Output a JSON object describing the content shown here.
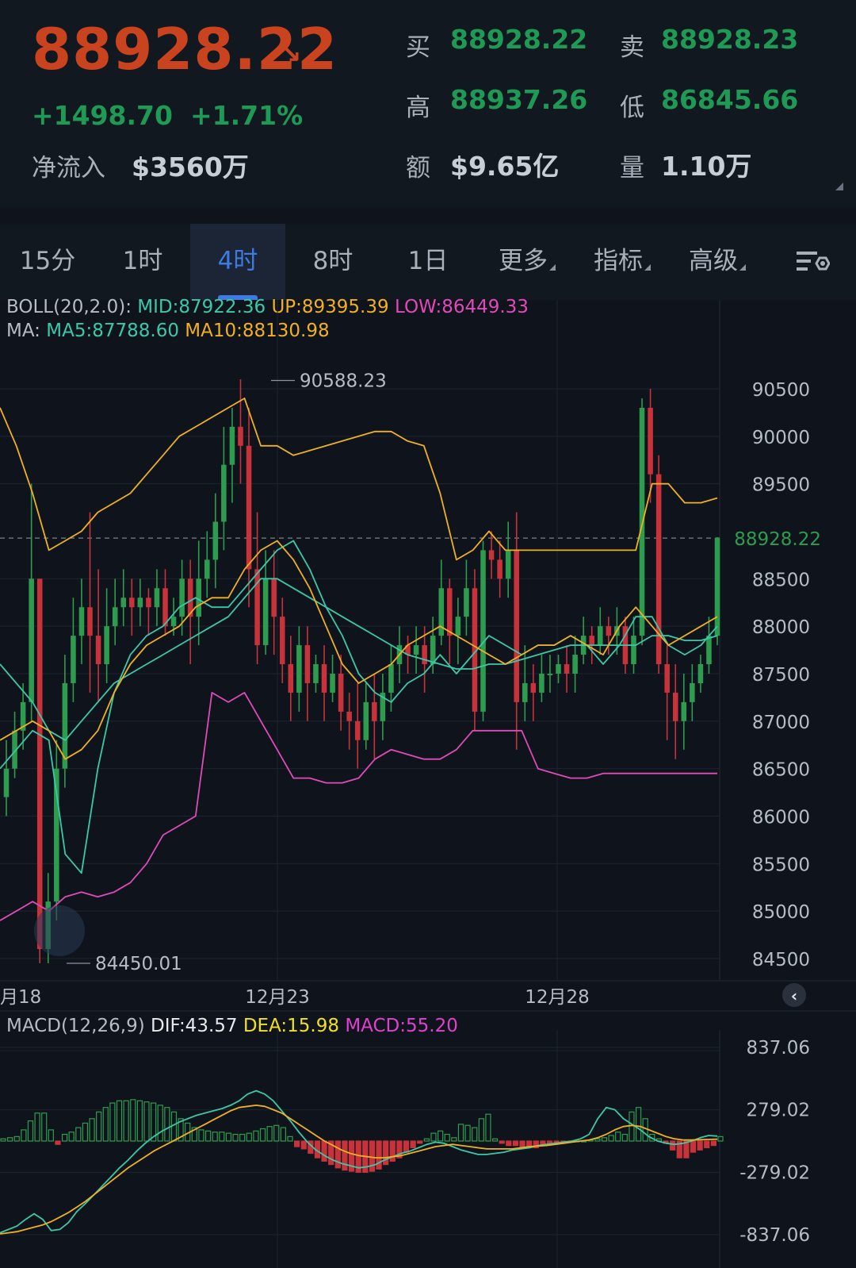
{
  "header": {
    "price": "88928.22",
    "change": "+1498.70",
    "change_pct": "+1.71%",
    "netflow_label": "净流入",
    "netflow_value": "$3560万",
    "bid_label": "买",
    "bid_value": "88928.22",
    "ask_label": "卖",
    "ask_value": "88928.23",
    "high_label": "高",
    "high_value": "88937.26",
    "low_label": "低",
    "low_value": "86845.66",
    "amount_label": "额",
    "amount_value": "$9.65亿",
    "volume_label": "量",
    "volume_value": "1.10万"
  },
  "tabs": [
    {
      "label": "15分"
    },
    {
      "label": "1时"
    },
    {
      "label": "4时"
    },
    {
      "label": "8时"
    },
    {
      "label": "1日"
    },
    {
      "label": "更多"
    },
    {
      "label": "指标"
    },
    {
      "label": "高级"
    }
  ],
  "active_tab": "4时",
  "indicators": {
    "boll_name": "BOLL(20,2.0):",
    "boll_mid": "MID:87922.36",
    "boll_up": "UP:89395.39",
    "boll_low": "LOW:86449.33",
    "ma_name": "MA:",
    "ma5": "MA5:87788.60",
    "ma10": "MA10:88130.98",
    "macd_name": "MACD(12,26,9)",
    "dif": "DIF:43.57",
    "dea": "DEA:15.98",
    "macd": "MACD:55.20"
  },
  "colors": {
    "up": "#2e9c4e",
    "down": "#c8323a",
    "boll_up_low_mid": "#f0b020",
    "boll_lower": "#e04ab8",
    "mid_line": "#3cc8a8",
    "ma5": "#3cc8a8",
    "ma10": "#f0b020",
    "price_accent": "#c8431e"
  },
  "chart_data": [
    {
      "type": "candlestick",
      "title": "",
      "y_ticks": [
        "90500",
        "90000",
        "89500",
        "88928.22",
        "88500",
        "88000",
        "87500",
        "87000",
        "86500",
        "86000",
        "85500",
        "85000",
        "84500"
      ],
      "ylim": [
        84400,
        90700
      ],
      "x_labels": [
        "月18",
        "12月23",
        "12月28"
      ],
      "high_mark": "90588.23",
      "low_mark": "84450.01",
      "last_price": 88928.22,
      "candles": [
        [
          86200,
          86500,
          86000,
          86800
        ],
        [
          86500,
          86900,
          86400,
          87100
        ],
        [
          86900,
          87200,
          86700,
          87400
        ],
        [
          87200,
          88500,
          87000,
          89500
        ],
        [
          88500,
          84600,
          84450,
          88500
        ],
        [
          84600,
          85100,
          84450,
          85400
        ],
        [
          85100,
          86500,
          84900,
          86800
        ],
        [
          86500,
          87400,
          86300,
          87700
        ],
        [
          87400,
          87900,
          87200,
          88300
        ],
        [
          87900,
          88200,
          87600,
          88500
        ],
        [
          88200,
          87900,
          87300,
          89200
        ],
        [
          87900,
          87600,
          87200,
          88600
        ],
        [
          87600,
          88000,
          87400,
          88400
        ],
        [
          88000,
          88200,
          87800,
          88500
        ],
        [
          88200,
          88300,
          88000,
          88600
        ],
        [
          88300,
          88200,
          87900,
          88500
        ],
        [
          88200,
          88300,
          88000,
          88500
        ],
        [
          88300,
          88200,
          87900,
          88400
        ],
        [
          88200,
          88400,
          88000,
          88600
        ],
        [
          88400,
          88000,
          87900,
          88600
        ],
        [
          88000,
          88100,
          87900,
          88300
        ],
        [
          88100,
          88500,
          87900,
          88700
        ],
        [
          88500,
          88100,
          87600,
          88700
        ],
        [
          88100,
          88500,
          87800,
          88900
        ],
        [
          88500,
          88700,
          88300,
          89000
        ],
        [
          88700,
          89100,
          88400,
          89400
        ],
        [
          89100,
          89700,
          88800,
          90100
        ],
        [
          89700,
          90100,
          89300,
          90300
        ],
        [
          90100,
          89900,
          89500,
          90600
        ],
        [
          89900,
          88600,
          88200,
          90300
        ],
        [
          88600,
          87800,
          87600,
          89200
        ],
        [
          87800,
          88500,
          87700,
          88800
        ],
        [
          88500,
          88100,
          87700,
          88800
        ],
        [
          88100,
          87600,
          87400,
          88300
        ],
        [
          87600,
          87300,
          87000,
          87900
        ],
        [
          87300,
          87800,
          87100,
          88000
        ],
        [
          87800,
          87400,
          87000,
          88000
        ],
        [
          87400,
          87600,
          87300,
          87700
        ],
        [
          87600,
          87300,
          87000,
          87800
        ],
        [
          87300,
          87500,
          87200,
          87700
        ],
        [
          87500,
          87100,
          86900,
          87700
        ],
        [
          87100,
          87000,
          86700,
          87300
        ],
        [
          87000,
          86800,
          86500,
          87400
        ],
        [
          86800,
          87200,
          86700,
          87400
        ],
        [
          87200,
          87000,
          86600,
          87500
        ],
        [
          87000,
          87300,
          86800,
          87500
        ],
        [
          87300,
          87600,
          87100,
          87800
        ],
        [
          87600,
          87800,
          87400,
          88000
        ],
        [
          87800,
          87700,
          87500,
          87900
        ],
        [
          87700,
          87800,
          87500,
          88000
        ],
        [
          87800,
          87600,
          87300,
          88000
        ],
        [
          87600,
          87900,
          87500,
          88100
        ],
        [
          87900,
          88400,
          87800,
          88700
        ],
        [
          88400,
          87900,
          87600,
          88500
        ],
        [
          87900,
          88100,
          87600,
          88300
        ],
        [
          88100,
          88400,
          87900,
          88700
        ],
        [
          88400,
          87100,
          86900,
          88600
        ],
        [
          87100,
          88800,
          87000,
          88900
        ],
        [
          88800,
          88700,
          88500,
          89000
        ],
        [
          88700,
          88500,
          88300,
          88900
        ],
        [
          88500,
          88800,
          88300,
          89100
        ],
        [
          88800,
          87200,
          86700,
          89200
        ],
        [
          87200,
          87400,
          87000,
          87800
        ],
        [
          87400,
          87300,
          87000,
          87600
        ],
        [
          87300,
          87500,
          87200,
          87700
        ],
        [
          87500,
          87500,
          87300,
          87700
        ],
        [
          87500,
          87600,
          87400,
          87700
        ],
        [
          87600,
          87500,
          87300,
          87800
        ],
        [
          87500,
          87700,
          87300,
          87900
        ],
        [
          87700,
          87900,
          87600,
          88100
        ],
        [
          87900,
          87800,
          87600,
          88000
        ],
        [
          87800,
          88000,
          87700,
          88200
        ],
        [
          88000,
          87900,
          87700,
          88100
        ],
        [
          87900,
          88000,
          87700,
          88200
        ],
        [
          88000,
          87600,
          87500,
          88100
        ],
        [
          87600,
          87900,
          87500,
          88100
        ],
        [
          87900,
          90300,
          87800,
          90400
        ],
        [
          90300,
          89600,
          89300,
          90500
        ],
        [
          89600,
          87600,
          87500,
          89800
        ],
        [
          87600,
          87300,
          86800,
          87800
        ],
        [
          87300,
          87000,
          86600,
          87600
        ],
        [
          87000,
          87200,
          86700,
          87500
        ],
        [
          87200,
          87400,
          87000,
          87600
        ],
        [
          87400,
          87600,
          87300,
          87700
        ],
        [
          87600,
          87900,
          87500,
          88100
        ],
        [
          87900,
          88928,
          87800,
          88937
        ]
      ],
      "series": [
        {
          "name": "UP",
          "values": [
            90300,
            89900,
            89400,
            88800,
            88900,
            89000,
            89200,
            89300,
            89400,
            89600,
            89800,
            90000,
            90100,
            90200,
            90300,
            90400,
            89900,
            89900,
            89800,
            89850,
            89900,
            89950,
            90000,
            90050,
            90050,
            89950,
            89900,
            89400,
            88700,
            88800,
            89000,
            88800,
            88800,
            88800,
            88800,
            88800,
            88800,
            88800,
            88800,
            88800,
            89500,
            89500,
            89300,
            89300,
            89350
          ]
        },
        {
          "name": "MID",
          "values": [
            87600,
            87400,
            87200,
            86900,
            86800,
            87000,
            87200,
            87400,
            87500,
            87600,
            87700,
            87800,
            87900,
            88000,
            88100,
            88300,
            88500,
            88500,
            88400,
            88300,
            88200,
            88100,
            88000,
            87900,
            87800,
            87700,
            87650,
            87600,
            87550,
            87550,
            87600,
            87600,
            87650,
            87700,
            87750,
            87800,
            87800,
            87800,
            87800,
            87800,
            87900,
            87900,
            87850,
            87850,
            87900
          ]
        },
        {
          "name": "LOW",
          "values": [
            84900,
            85000,
            85100,
            85000,
            85150,
            85200,
            85150,
            85200,
            85300,
            85500,
            85800,
            85900,
            86000,
            87300,
            87200,
            87300,
            87000,
            86700,
            86400,
            86400,
            86350,
            86350,
            86400,
            86600,
            86700,
            86650,
            86600,
            86600,
            86700,
            86900,
            86900,
            86900,
            86900,
            86500,
            86450,
            86400,
            86400,
            86450,
            86450,
            86450,
            86450,
            86450,
            86450,
            86450,
            86450
          ]
        },
        {
          "name": "MA5",
          "values": [
            86500,
            86700,
            86900,
            86800,
            85600,
            85400,
            86500,
            87300,
            87700,
            87900,
            88000,
            88200,
            88300,
            88200,
            88200,
            88400,
            88600,
            88800,
            88900,
            88600,
            88200,
            87900,
            87500,
            87300,
            87200,
            87400,
            87500,
            87700,
            87500,
            87700,
            87900,
            87800,
            87700,
            87800,
            87800,
            87900,
            87800,
            87600,
            87800,
            88100,
            88100,
            87800,
            87700,
            87800,
            88000
          ]
        },
        {
          "name": "MA10",
          "values": [
            86800,
            86900,
            87000,
            86900,
            86600,
            86700,
            86900,
            87300,
            87600,
            87800,
            87900,
            88000,
            88200,
            88300,
            88300,
            88600,
            88800,
            88900,
            88700,
            88400,
            88000,
            87600,
            87400,
            87500,
            87600,
            87800,
            87900,
            88000,
            87900,
            87800,
            87700,
            87600,
            87700,
            87800,
            87800,
            87900,
            87800,
            87700,
            88000,
            88200,
            88000,
            87800,
            87900,
            88000,
            88100
          ]
        }
      ]
    },
    {
      "type": "bar",
      "title": "",
      "y_ticks": [
        "837.06",
        "279.02",
        "-279.02",
        "-837.06"
      ],
      "ylim": [
        -837.06,
        837.06
      ],
      "macd_hist": [
        20,
        30,
        40,
        100,
        180,
        250,
        250,
        100,
        -30,
        60,
        80,
        120,
        160,
        200,
        260,
        300,
        340,
        360,
        360,
        370,
        360,
        350,
        340,
        320,
        300,
        260,
        200,
        160,
        120,
        100,
        90,
        80,
        80,
        70,
        60,
        60,
        70,
        90,
        110,
        130,
        140,
        120,
        40,
        -50,
        -70,
        -110,
        -150,
        -180,
        -210,
        -240,
        -260,
        -270,
        -280,
        -280,
        -270,
        -250,
        -210,
        -180,
        -150,
        -100,
        -60,
        -20,
        20,
        70,
        90,
        60,
        30,
        150,
        140,
        120,
        200,
        240,
        20,
        -20,
        -40,
        -40,
        -60,
        -60,
        -60,
        -40,
        -20,
        -20,
        -10,
        -5,
        0,
        0,
        10,
        20,
        30,
        50,
        80,
        60,
        260,
        300,
        200,
        60,
        20,
        -20,
        -80,
        -150,
        -150,
        -100,
        -80,
        -60,
        -40,
        40
      ],
      "dif": [
        -820,
        -790,
        -760,
        -700,
        -650,
        -700,
        -800,
        -790,
        -730,
        -630,
        -560,
        -480,
        -400,
        -320,
        -240,
        -170,
        -90,
        -20,
        40,
        90,
        130,
        170,
        200,
        230,
        250,
        270,
        290,
        320,
        360,
        420,
        450,
        420,
        360,
        270,
        180,
        80,
        -10,
        -80,
        -130,
        -170,
        -200,
        -220,
        -240,
        -230,
        -210,
        -170,
        -140,
        -110,
        -90,
        -60,
        -30,
        -10,
        -20,
        -50,
        -80,
        -100,
        -120,
        -120,
        -110,
        -100,
        -80,
        -70,
        -60,
        -40,
        -30,
        -20,
        -10,
        0,
        20,
        60,
        200,
        300,
        280,
        200,
        150,
        100,
        40,
        0,
        -20,
        -30,
        -20,
        0,
        30,
        50,
        44
      ],
      "dea": [
        -830,
        -820,
        -810,
        -790,
        -770,
        -750,
        -720,
        -680,
        -640,
        -590,
        -540,
        -480,
        -420,
        -360,
        -300,
        -240,
        -190,
        -140,
        -90,
        -50,
        -10,
        30,
        70,
        110,
        150,
        190,
        230,
        270,
        300,
        310,
        320,
        310,
        280,
        250,
        200,
        150,
        100,
        50,
        0,
        -40,
        -80,
        -110,
        -130,
        -140,
        -150,
        -150,
        -140,
        -130,
        -110,
        -90,
        -70,
        -50,
        -40,
        -30,
        -40,
        -50,
        -60,
        -70,
        -70,
        -70,
        -70,
        -60,
        -50,
        -45,
        -40,
        -30,
        -20,
        -10,
        0,
        10,
        30,
        60,
        100,
        130,
        140,
        130,
        100,
        70,
        40,
        20,
        10,
        10,
        12,
        14,
        16
      ]
    }
  ]
}
